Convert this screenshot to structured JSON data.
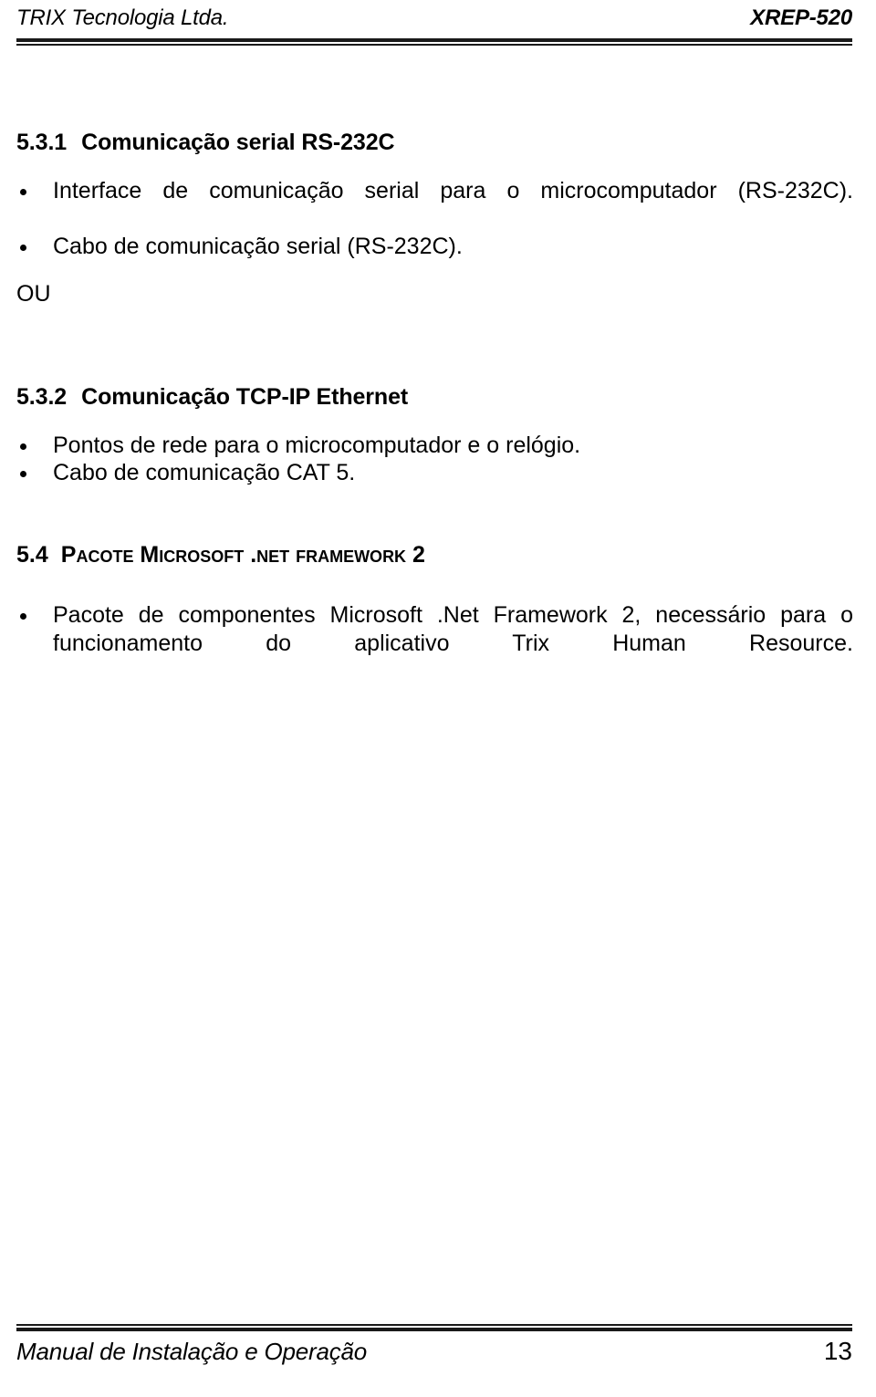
{
  "header": {
    "company": "TRIX Tecnologia Ltda.",
    "product_code": "XREP-520"
  },
  "sections": [
    {
      "number": "5.3.1",
      "title": "Comunicação serial RS-232C",
      "bullets": [
        "Interface de comunicação serial para o microcomputador (RS-232C).",
        "Cabo de comunicação serial (RS-232C)."
      ]
    },
    {
      "separator": "OU"
    },
    {
      "number": "5.3.2",
      "title": "Comunicação TCP-IP Ethernet",
      "bullets": [
        "Pontos de rede para o microcomputador e o relógio.",
        "Cabo de comunicação CAT 5."
      ]
    },
    {
      "number": "5.4",
      "title_lead_1": "P",
      "title_rest_1": "acote",
      "title_lead_2": "M",
      "title_rest_2": "icrosoft",
      "title_rest_3": ".net framework",
      "title_tail": "2",
      "title_full": "5.4 PACOTE MICROSOFT .NET FRAMEWORK 2",
      "bullets": [
        "Pacote de componentes Microsoft .Net Framework 2, necessário para o funcionamento do aplicativo Trix Human Resource."
      ]
    }
  ],
  "footer": {
    "document_title": "Manual de Instalação e Operação",
    "page_number": "13"
  }
}
